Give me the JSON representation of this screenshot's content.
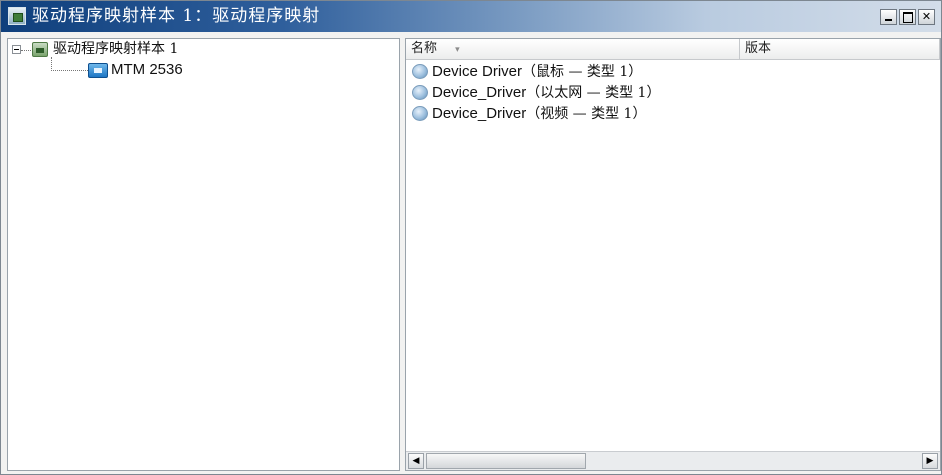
{
  "window": {
    "title": "驱动程序映射样本 1：驱动程序映射",
    "icon": "app-icon",
    "controls": [
      "minimize",
      "maximize",
      "close"
    ]
  },
  "tree": {
    "root": {
      "label": "驱动程序映射样本 1",
      "icon": "driver-map-icon",
      "expanded": true,
      "children": [
        {
          "label": "MTM 2536",
          "icon": "machine-type-icon"
        }
      ]
    }
  },
  "list": {
    "columns": [
      {
        "label": "名称",
        "sort_icon": "▾"
      },
      {
        "label": "版本"
      }
    ],
    "rows": [
      {
        "name": "Device Driver",
        "desc": "（鼠标 — 类型 1）",
        "version": ""
      },
      {
        "name": "Device_Driver",
        "desc": "（以太网 — 类型 1）",
        "version": ""
      },
      {
        "name": "Device_Driver",
        "desc": "（视频 — 类型 1）",
        "version": ""
      }
    ],
    "scrollbar": {
      "left_arrow": "◀",
      "right_arrow": "▶"
    }
  }
}
